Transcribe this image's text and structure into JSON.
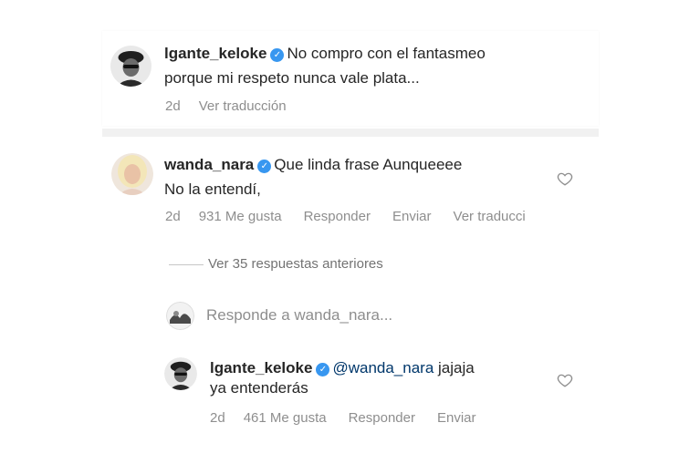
{
  "comments": {
    "top": {
      "username": "lgante_keloke",
      "text_line1": "No compro con el fantasmeo",
      "text_line2": "porque mi respeto nunca vale plata...",
      "time": "2d",
      "translate": "Ver traducción"
    },
    "wanda": {
      "username": "wanda_nara",
      "text_line1": "Que linda frase Aunqueeee",
      "text_line2": "No la entendí,",
      "time": "2d",
      "likes": "931 Me gusta",
      "reply": "Responder",
      "send": "Enviar",
      "translate": "Ver traducci"
    },
    "view_replies": "Ver 35 respuestas anteriores",
    "reply_input": {
      "placeholder": "Responde a wanda_nara..."
    },
    "reply": {
      "username": "lgante_keloke",
      "mention": "@wanda_nara",
      "text_rest": "jajaja",
      "text_line2": "ya entenderás",
      "time": "2d",
      "likes": "461 Me gusta",
      "reply": "Responder",
      "send": "Enviar"
    }
  },
  "colors": {
    "verified": "#3897f0",
    "meta": "#8e8e8e",
    "mention": "#00376b"
  }
}
